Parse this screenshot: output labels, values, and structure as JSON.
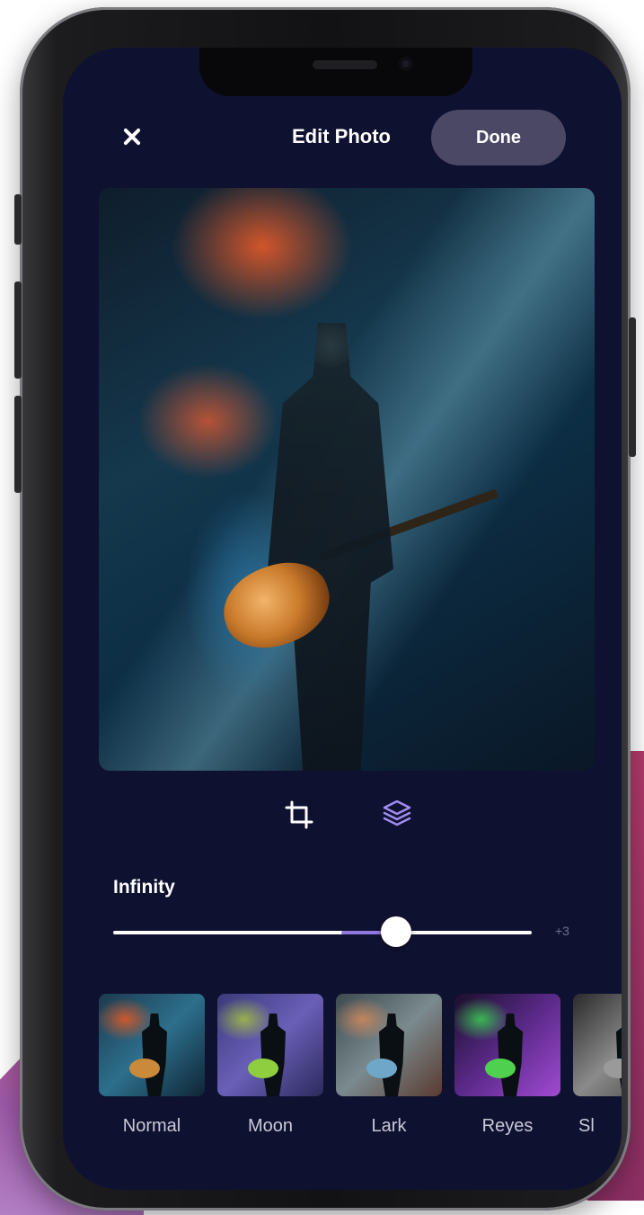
{
  "header": {
    "title": "Edit Photo",
    "done_label": "Done"
  },
  "tools": {
    "crop_icon": "crop-icon",
    "layers_icon": "layers-icon"
  },
  "filter": {
    "name": "Infinity",
    "intensity_label": "+3",
    "intensity_fraction": 0.68
  },
  "filters": [
    {
      "label": "Normal"
    },
    {
      "label": "Moon"
    },
    {
      "label": "Lark"
    },
    {
      "label": "Reyes"
    },
    {
      "label": "Sl"
    }
  ],
  "colors": {
    "screen_background": "#0f1130",
    "accent": "#8f78e0",
    "done_button": "#4b4866",
    "brand_pink": "#b23a6a"
  }
}
